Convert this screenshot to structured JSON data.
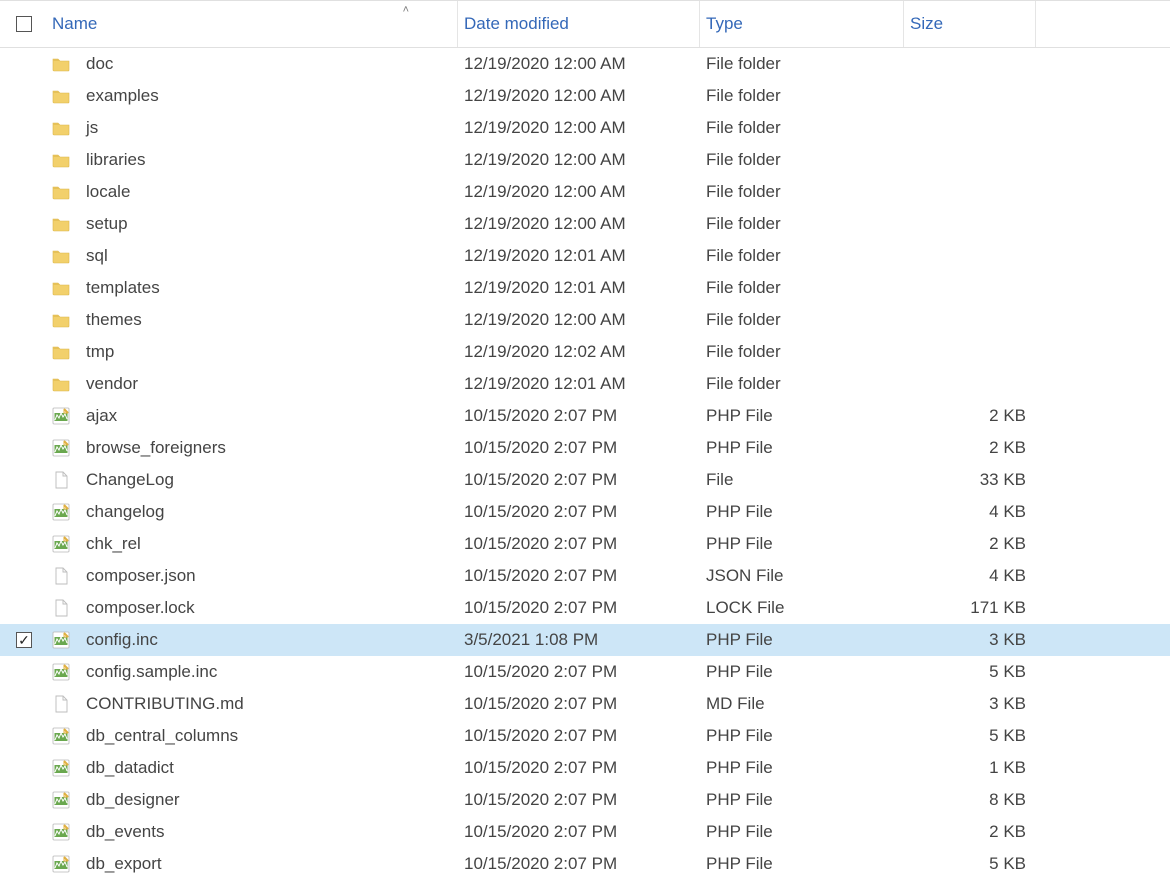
{
  "columns": {
    "name": "Name",
    "date": "Date modified",
    "type": "Type",
    "size": "Size"
  },
  "sort": {
    "column": "name",
    "direction": "asc"
  },
  "rows": [
    {
      "icon": "folder",
      "name": "doc",
      "date": "12/19/2020 12:00 AM",
      "type": "File folder",
      "size": "",
      "selected": false
    },
    {
      "icon": "folder",
      "name": "examples",
      "date": "12/19/2020 12:00 AM",
      "type": "File folder",
      "size": "",
      "selected": false
    },
    {
      "icon": "folder",
      "name": "js",
      "date": "12/19/2020 12:00 AM",
      "type": "File folder",
      "size": "",
      "selected": false
    },
    {
      "icon": "folder",
      "name": "libraries",
      "date": "12/19/2020 12:00 AM",
      "type": "File folder",
      "size": "",
      "selected": false
    },
    {
      "icon": "folder",
      "name": "locale",
      "date": "12/19/2020 12:00 AM",
      "type": "File folder",
      "size": "",
      "selected": false
    },
    {
      "icon": "folder",
      "name": "setup",
      "date": "12/19/2020 12:00 AM",
      "type": "File folder",
      "size": "",
      "selected": false
    },
    {
      "icon": "folder",
      "name": "sql",
      "date": "12/19/2020 12:01 AM",
      "type": "File folder",
      "size": "",
      "selected": false
    },
    {
      "icon": "folder",
      "name": "templates",
      "date": "12/19/2020 12:01 AM",
      "type": "File folder",
      "size": "",
      "selected": false
    },
    {
      "icon": "folder",
      "name": "themes",
      "date": "12/19/2020 12:00 AM",
      "type": "File folder",
      "size": "",
      "selected": false
    },
    {
      "icon": "folder",
      "name": "tmp",
      "date": "12/19/2020 12:02 AM",
      "type": "File folder",
      "size": "",
      "selected": false
    },
    {
      "icon": "folder",
      "name": "vendor",
      "date": "12/19/2020 12:01 AM",
      "type": "File folder",
      "size": "",
      "selected": false
    },
    {
      "icon": "php",
      "name": "ajax",
      "date": "10/15/2020 2:07 PM",
      "type": "PHP File",
      "size": "2 KB",
      "selected": false
    },
    {
      "icon": "php",
      "name": "browse_foreigners",
      "date": "10/15/2020 2:07 PM",
      "type": "PHP File",
      "size": "2 KB",
      "selected": false
    },
    {
      "icon": "file",
      "name": "ChangeLog",
      "date": "10/15/2020 2:07 PM",
      "type": "File",
      "size": "33 KB",
      "selected": false
    },
    {
      "icon": "php",
      "name": "changelog",
      "date": "10/15/2020 2:07 PM",
      "type": "PHP File",
      "size": "4 KB",
      "selected": false
    },
    {
      "icon": "php",
      "name": "chk_rel",
      "date": "10/15/2020 2:07 PM",
      "type": "PHP File",
      "size": "2 KB",
      "selected": false
    },
    {
      "icon": "file",
      "name": "composer.json",
      "date": "10/15/2020 2:07 PM",
      "type": "JSON File",
      "size": "4 KB",
      "selected": false
    },
    {
      "icon": "file",
      "name": "composer.lock",
      "date": "10/15/2020 2:07 PM",
      "type": "LOCK File",
      "size": "171 KB",
      "selected": false
    },
    {
      "icon": "php",
      "name": "config.inc",
      "date": "3/5/2021 1:08 PM",
      "type": "PHP File",
      "size": "3 KB",
      "selected": true
    },
    {
      "icon": "php",
      "name": "config.sample.inc",
      "date": "10/15/2020 2:07 PM",
      "type": "PHP File",
      "size": "5 KB",
      "selected": false
    },
    {
      "icon": "file",
      "name": "CONTRIBUTING.md",
      "date": "10/15/2020 2:07 PM",
      "type": "MD File",
      "size": "3 KB",
      "selected": false
    },
    {
      "icon": "php",
      "name": "db_central_columns",
      "date": "10/15/2020 2:07 PM",
      "type": "PHP File",
      "size": "5 KB",
      "selected": false
    },
    {
      "icon": "php",
      "name": "db_datadict",
      "date": "10/15/2020 2:07 PM",
      "type": "PHP File",
      "size": "1 KB",
      "selected": false
    },
    {
      "icon": "php",
      "name": "db_designer",
      "date": "10/15/2020 2:07 PM",
      "type": "PHP File",
      "size": "8 KB",
      "selected": false
    },
    {
      "icon": "php",
      "name": "db_events",
      "date": "10/15/2020 2:07 PM",
      "type": "PHP File",
      "size": "2 KB",
      "selected": false
    },
    {
      "icon": "php",
      "name": "db_export",
      "date": "10/15/2020 2:07 PM",
      "type": "PHP File",
      "size": "5 KB",
      "selected": false
    }
  ]
}
